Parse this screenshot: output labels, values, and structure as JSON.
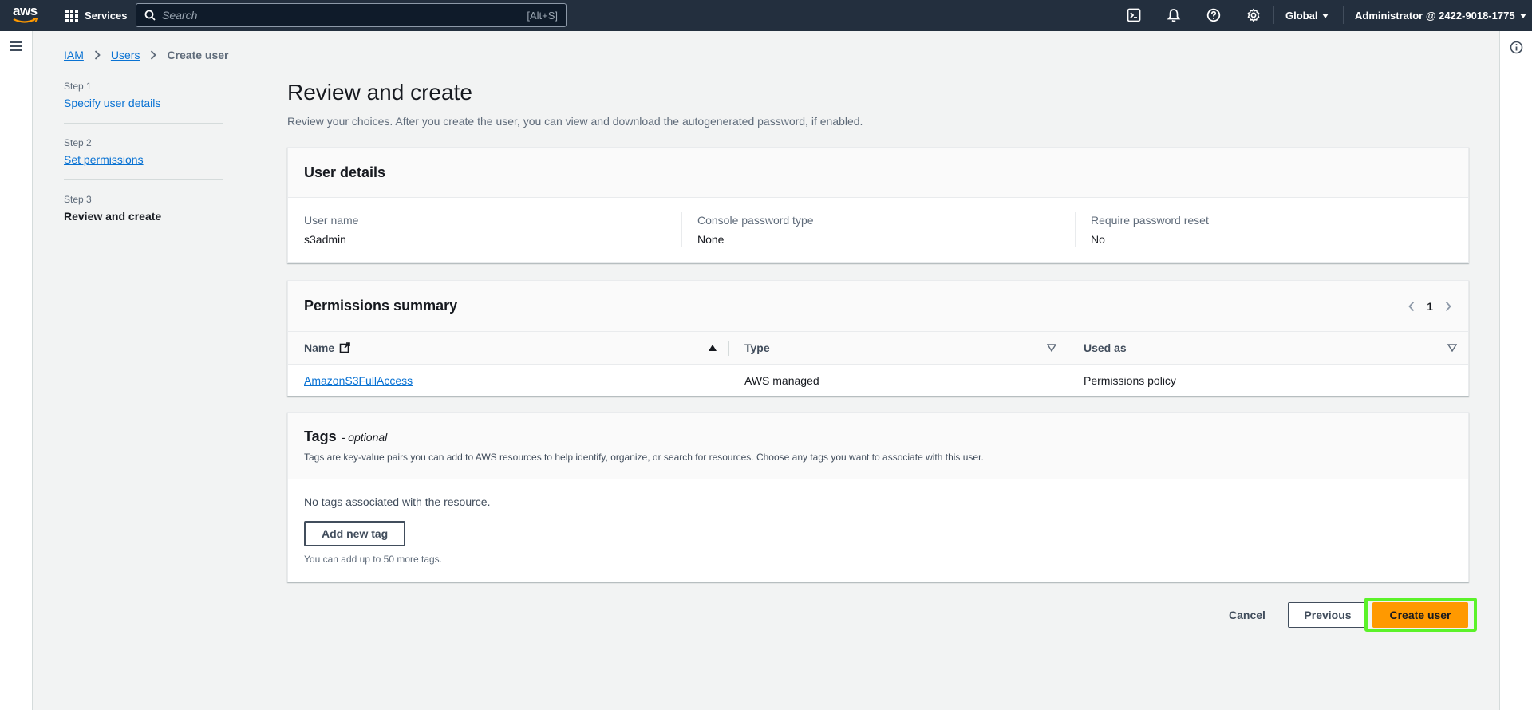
{
  "topnav": {
    "logo_text": "aws",
    "services_label": "Services",
    "search_placeholder": "Search",
    "search_shortcut": "[Alt+S]",
    "region_label": "Global",
    "account_label": "Administrator @ 2422-9018-1775",
    "icons": [
      "cloudshell-icon",
      "bell-icon",
      "help-icon",
      "gear-icon"
    ]
  },
  "breadcrumb": {
    "items": [
      "IAM",
      "Users"
    ],
    "current": "Create user"
  },
  "steps": [
    {
      "number": "Step 1",
      "label": "Specify user details"
    },
    {
      "number": "Step 2",
      "label": "Set permissions"
    },
    {
      "number": "Step 3",
      "label": "Review and create"
    }
  ],
  "page": {
    "title": "Review and create",
    "description": "Review your choices. After you create the user, you can view and download the autogenerated password, if enabled."
  },
  "user_details": {
    "title": "User details",
    "fields": [
      {
        "label": "User name",
        "value": "s3admin"
      },
      {
        "label": "Console password type",
        "value": "None"
      },
      {
        "label": "Require password reset",
        "value": "No"
      }
    ]
  },
  "permissions": {
    "title": "Permissions summary",
    "page": "1",
    "columns": [
      "Name",
      "Type",
      "Used as"
    ],
    "rows": [
      {
        "name": "AmazonS3FullAccess",
        "type": "AWS managed",
        "used_as": "Permissions policy"
      }
    ]
  },
  "tags": {
    "title": "Tags",
    "optional": "- optional",
    "description": "Tags are key-value pairs you can add to AWS resources to help identify, organize, or search for resources. Choose any tags you want to associate with this user.",
    "empty": "No tags associated with the resource.",
    "add_button": "Add new tag",
    "hint": "You can add up to 50 more tags."
  },
  "actions": {
    "cancel": "Cancel",
    "previous": "Previous",
    "create": "Create user"
  },
  "colors": {
    "nav_bg": "#232f3e",
    "link": "#0972d3",
    "primary": "#ff9900",
    "highlight": "#5bf229"
  }
}
